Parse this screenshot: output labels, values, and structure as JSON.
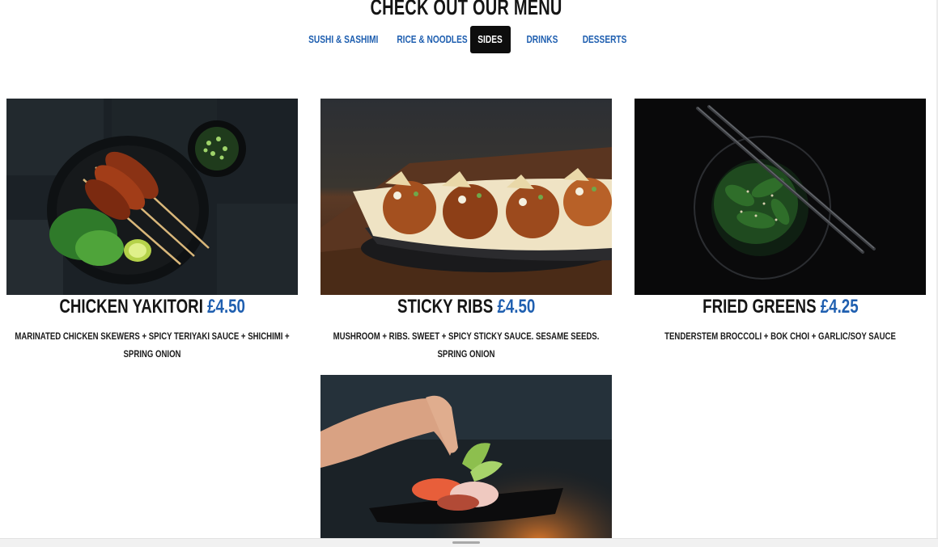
{
  "section": {
    "heading": "CHECK OUT OUR MENU"
  },
  "tabs": [
    {
      "label": "SUSHI & SASHIMI",
      "active": false
    },
    {
      "label": "RICE & NOODLES",
      "active": false
    },
    {
      "label": "SIDES",
      "active": true
    },
    {
      "label": "DRINKS",
      "active": false
    },
    {
      "label": "DESSERTS",
      "active": false
    }
  ],
  "items": [
    {
      "name": "CHICKEN YAKITORI",
      "price": "£4.50",
      "description": "MARINATED CHICKEN SKEWERS + SPICY TERIYAKI SAUCE + SHICHIMI + SPRING ONION",
      "image": "chicken-skewers-plate"
    },
    {
      "name": "STICKY RIBS",
      "price": "£4.50",
      "description": "MUSHROOM + RIBS. SWEET + SPICY STICKY SAUCE. SESAME SEEDS. SPRING ONION",
      "image": "takoyaki-balls-dish"
    },
    {
      "name": "FRIED GREENS",
      "price": "£4.25",
      "description": "TENDERSTEM BROCCOLI + BOK CHOI + GARLIC/SOY SAUCE",
      "image": "greens-bowl-chopsticks"
    },
    {
      "image": "hand-plating-sashimi"
    }
  ],
  "colors": {
    "accent": "#1f5fb0",
    "active_tab_bg": "#0d0d0d",
    "text": "#151515"
  }
}
